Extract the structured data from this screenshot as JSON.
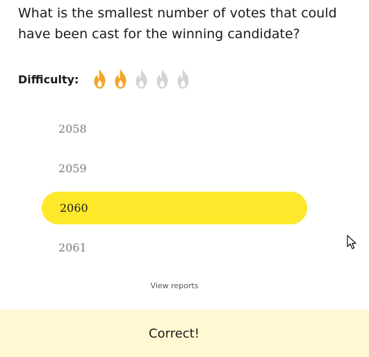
{
  "question": {
    "text": "What is the smallest number of votes that could have been cast for the winning candidate?"
  },
  "difficulty": {
    "label": "Difficulty:",
    "level": 2,
    "max": 5,
    "active_color": "#f2a52a",
    "inactive_color": "#d4d4d4",
    "icon": "flame-icon"
  },
  "options": [
    {
      "label": "2058",
      "selected": false
    },
    {
      "label": "2059",
      "selected": false
    },
    {
      "label": "2060",
      "selected": true
    },
    {
      "label": "2061",
      "selected": false
    }
  ],
  "view_reports": {
    "label": "View reports"
  },
  "result": {
    "text": "Correct!",
    "background": "#fff8d3"
  },
  "colors": {
    "selected_option": "#fde82b"
  }
}
